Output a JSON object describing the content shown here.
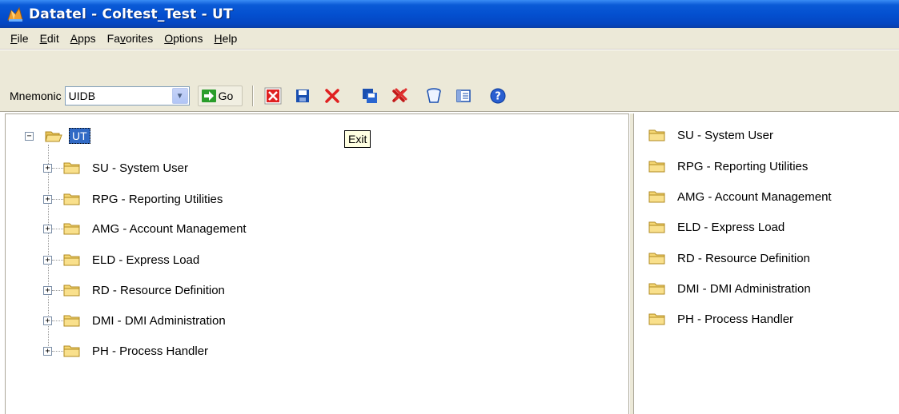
{
  "window": {
    "title": "Datatel - Coltest_Test - UT"
  },
  "menu": [
    {
      "label": "File",
      "accel": "F",
      "rest": "ile"
    },
    {
      "label": "Edit",
      "accel": "E",
      "rest": "dit"
    },
    {
      "label": "Apps",
      "accel": "A",
      "rest": "pps"
    },
    {
      "label": "Favorites",
      "pre": "Fa",
      "accel": "v",
      "rest": "orites"
    },
    {
      "label": "Options",
      "accel": "O",
      "rest": "ptions"
    },
    {
      "label": "Help",
      "accel": "H",
      "rest": "elp"
    }
  ],
  "toolbar": {
    "mnemonic_label": "Mnemonic",
    "mnemonic_value": "UIDB",
    "go_label": "Go"
  },
  "tooltip": "Exit",
  "tree": {
    "root_label": "UT",
    "root_expander": "−",
    "node_expander": "+",
    "nodes": [
      {
        "label": "SU - System User"
      },
      {
        "label": "RPG - Reporting Utilities"
      },
      {
        "label": "AMG - Account Management"
      },
      {
        "label": "ELD - Express Load"
      },
      {
        "label": "RD - Resource Definition"
      },
      {
        "label": "DMI - DMI Administration"
      },
      {
        "label": "PH - Process Handler"
      }
    ]
  },
  "list": [
    {
      "label": "SU - System User"
    },
    {
      "label": "RPG - Reporting Utilities"
    },
    {
      "label": "AMG - Account Management"
    },
    {
      "label": "ELD - Express Load"
    },
    {
      "label": "RD - Resource Definition"
    },
    {
      "label": "DMI - DMI Administration"
    },
    {
      "label": "PH - Process Handler"
    }
  ],
  "colors": {
    "titlebar": "#0450d0",
    "chrome": "#ece9d8",
    "selection": "#316ac5",
    "tooltip_bg": "#ffffe1",
    "folder": "#f5d774"
  }
}
